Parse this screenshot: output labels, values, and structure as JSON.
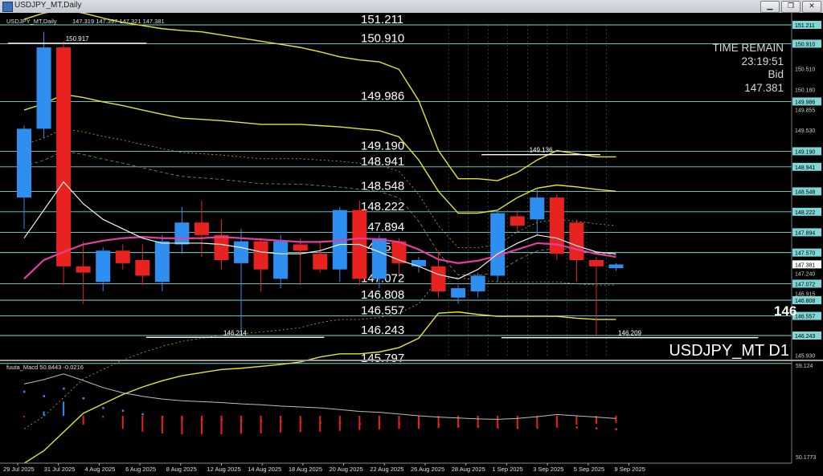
{
  "window": {
    "title": "USDJPY_MT,Daily",
    "buttons": {
      "minimize": "▁",
      "restore": "❐",
      "close": "✕"
    }
  },
  "header": {
    "symbol_info": "USDJPY_MT,Daily",
    "ohlc": "147.319 147.397 147.321 147.381"
  },
  "info_panel": {
    "line1": "TIME REMAIN",
    "line2": "23:19:51",
    "line3": "Bid",
    "line4": "147.381"
  },
  "watermark": "USDJPY_MT D1",
  "big_digit_fragment": "146",
  "colors": {
    "bull": "#2f8ff0",
    "bear": "#e8231f",
    "band": "#e6e62a",
    "hline": "#7ed6d6",
    "ma_pink": "#e040a0",
    "ma_white": "#f2f2f2",
    "grid": "#5a5a5a"
  },
  "level_lines": [
    {
      "price": "151.211",
      "val": 151.211
    },
    {
      "price": "150.910",
      "val": 150.91
    },
    {
      "price": "149.986",
      "val": 149.986
    },
    {
      "price": "149.190",
      "val": 149.19
    },
    {
      "price": "148.941",
      "val": 148.941
    },
    {
      "price": "148.548",
      "val": 148.548
    },
    {
      "price": "148.222",
      "val": 148.222
    },
    {
      "price": "147.894",
      "val": 147.894
    },
    {
      "price": "147.570",
      "val": 147.57
    },
    {
      "price": "147.072",
      "val": 147.072
    },
    {
      "price": "146.808",
      "val": 146.808
    },
    {
      "price": "146.557",
      "val": 146.557
    },
    {
      "price": "146.243",
      "val": 146.243
    },
    {
      "price": "145.797",
      "val": 145.797
    }
  ],
  "axis_prices": [
    {
      "price": "151.211",
      "val": 151.211,
      "boxed": true
    },
    {
      "price": "150.910",
      "val": 150.91,
      "boxed": true
    },
    {
      "price": "150.510",
      "val": 150.51,
      "boxed": false
    },
    {
      "price": "150.180",
      "val": 150.18,
      "boxed": false
    },
    {
      "price": "149.986",
      "val": 149.986,
      "boxed": true
    },
    {
      "price": "149.855",
      "val": 149.855,
      "boxed": false
    },
    {
      "price": "149.530",
      "val": 149.53,
      "boxed": false
    },
    {
      "price": "149.190",
      "val": 149.19,
      "boxed": true
    },
    {
      "price": "148.941",
      "val": 148.941,
      "boxed": true
    },
    {
      "price": "148.548",
      "val": 148.548,
      "boxed": true
    },
    {
      "price": "148.222",
      "val": 148.222,
      "boxed": true
    },
    {
      "price": "147.894",
      "val": 147.894,
      "boxed": true
    },
    {
      "price": "147.570",
      "val": 147.57,
      "boxed": true
    },
    {
      "price": "147.381",
      "val": 147.381,
      "boxed": "white"
    },
    {
      "price": "147.240",
      "val": 147.24,
      "boxed": false
    },
    {
      "price": "147.072",
      "val": 147.072,
      "boxed": true
    },
    {
      "price": "146.915",
      "val": 146.915,
      "boxed": false
    },
    {
      "price": "146.808",
      "val": 146.808,
      "boxed": true
    },
    {
      "price": "146.557",
      "val": 146.557,
      "boxed": true
    },
    {
      "price": "146.243",
      "val": 146.243,
      "boxed": true
    },
    {
      "price": "145.930",
      "val": 145.93,
      "boxed": false
    }
  ],
  "marker_labels": [
    {
      "text": "150.917",
      "val": 150.917,
      "i0": 0,
      "i1": 6
    },
    {
      "text": "149.136",
      "val": 149.136,
      "i0": 24,
      "i1": 29
    },
    {
      "text": "146.214",
      "val": 146.214,
      "i0": 7,
      "i1": 15
    },
    {
      "text": "146.209",
      "val": 146.209,
      "i0": 25,
      "i1": 37
    }
  ],
  "dates": [
    "29 Jul 2025",
    "31 Jul 2025",
    "4 Aug 2025",
    "6 Aug 2025",
    "8 Aug 2025",
    "12 Aug 2025",
    "14 Aug 2025",
    "18 Aug 2025",
    "20 Aug 2025",
    "22 Aug 2025",
    "26 Aug 2025",
    "28 Aug 2025",
    "1 Sep 2025",
    "3 Sep 2025",
    "5 Sep 2025",
    "9 Sep 2025"
  ],
  "chart_data": {
    "type": "candlestick",
    "candles": [
      {
        "o": 148.45,
        "h": 149.6,
        "l": 147.95,
        "c": 149.55
      },
      {
        "o": 149.55,
        "h": 151.1,
        "l": 149.4,
        "c": 150.85
      },
      {
        "o": 150.85,
        "h": 150.95,
        "l": 147.05,
        "c": 147.35
      },
      {
        "o": 147.35,
        "h": 147.75,
        "l": 146.75,
        "c": 147.25
      },
      {
        "o": 147.1,
        "h": 147.65,
        "l": 146.95,
        "c": 147.6
      },
      {
        "o": 147.6,
        "h": 147.7,
        "l": 147.3,
        "c": 147.4
      },
      {
        "o": 147.45,
        "h": 147.7,
        "l": 147.05,
        "c": 147.2
      },
      {
        "o": 147.1,
        "h": 147.85,
        "l": 146.95,
        "c": 147.75
      },
      {
        "o": 147.7,
        "h": 148.3,
        "l": 147.55,
        "c": 148.05
      },
      {
        "o": 148.05,
        "h": 148.4,
        "l": 147.5,
        "c": 147.85
      },
      {
        "o": 147.85,
        "h": 148.1,
        "l": 147.3,
        "c": 147.45
      },
      {
        "o": 147.4,
        "h": 147.95,
        "l": 146.25,
        "c": 147.75
      },
      {
        "o": 147.75,
        "h": 147.8,
        "l": 146.95,
        "c": 147.3
      },
      {
        "o": 147.15,
        "h": 147.85,
        "l": 147.0,
        "c": 147.75
      },
      {
        "o": 147.7,
        "h": 147.8,
        "l": 147.05,
        "c": 147.6
      },
      {
        "o": 147.55,
        "h": 147.75,
        "l": 147.25,
        "c": 147.3
      },
      {
        "o": 147.3,
        "h": 148.3,
        "l": 147.1,
        "c": 148.25
      },
      {
        "o": 148.25,
        "h": 148.4,
        "l": 147.05,
        "c": 147.15
      },
      {
        "o": 147.15,
        "h": 147.85,
        "l": 147.0,
        "c": 147.8
      },
      {
        "o": 147.75,
        "h": 147.8,
        "l": 147.2,
        "c": 147.4
      },
      {
        "o": 147.35,
        "h": 147.5,
        "l": 147.25,
        "c": 147.45
      },
      {
        "o": 147.35,
        "h": 147.6,
        "l": 146.85,
        "c": 146.95
      },
      {
        "o": 146.85,
        "h": 147.05,
        "l": 146.75,
        "c": 147.0
      },
      {
        "o": 146.95,
        "h": 147.25,
        "l": 146.85,
        "c": 147.2
      },
      {
        "o": 147.2,
        "h": 148.25,
        "l": 147.1,
        "c": 148.2
      },
      {
        "o": 148.15,
        "h": 148.25,
        "l": 147.9,
        "c": 148.0
      },
      {
        "o": 148.1,
        "h": 148.6,
        "l": 147.85,
        "c": 148.45
      },
      {
        "o": 148.45,
        "h": 148.5,
        "l": 147.45,
        "c": 147.55
      },
      {
        "o": 148.05,
        "h": 148.1,
        "l": 147.1,
        "c": 147.45
      },
      {
        "o": 147.45,
        "h": 147.5,
        "l": 146.25,
        "c": 147.35
      },
      {
        "o": 147.32,
        "h": 147.4,
        "l": 147.28,
        "c": 147.38
      }
    ],
    "ma_pink": [
      147.15,
      147.45,
      147.58,
      147.7,
      147.76,
      147.8,
      147.82,
      147.8,
      147.8,
      147.8,
      147.82,
      147.8,
      147.78,
      147.76,
      147.74,
      147.74,
      147.76,
      147.8,
      147.78,
      147.74,
      147.62,
      147.46,
      147.4,
      147.44,
      147.52,
      147.62,
      147.72,
      147.7,
      147.62,
      147.55,
      147.5
    ],
    "ma_white": [
      147.8,
      148.25,
      148.7,
      148.35,
      148.1,
      147.95,
      147.8,
      147.72,
      147.72,
      147.72,
      147.7,
      147.65,
      147.58,
      147.55,
      147.55,
      147.6,
      147.7,
      147.7,
      147.58,
      147.45,
      147.35,
      147.22,
      147.15,
      147.3,
      147.55,
      147.72,
      147.85,
      147.8,
      147.68,
      147.58,
      147.55
    ],
    "band_outer_top": [
      151.3,
      151.4,
      151.45,
      151.4,
      151.32,
      151.25,
      151.2,
      151.15,
      151.12,
      151.1,
      151.05,
      151.0,
      150.95,
      150.9,
      150.85,
      150.78,
      150.7,
      150.65,
      150.62,
      150.5,
      150.0,
      149.2,
      148.75,
      148.75,
      148.72,
      148.85,
      149.05,
      149.2,
      149.15,
      149.1,
      149.1
    ],
    "band_top": [
      149.85,
      149.95,
      150.1,
      150.05,
      149.98,
      149.92,
      149.85,
      149.78,
      149.72,
      149.7,
      149.68,
      149.65,
      149.62,
      149.62,
      149.62,
      149.6,
      149.58,
      149.55,
      149.52,
      149.42,
      149.05,
      148.55,
      148.2,
      148.2,
      148.25,
      148.45,
      148.6,
      148.65,
      148.62,
      148.58,
      148.55
    ],
    "band_bottom": [
      144.2,
      144.4,
      144.7,
      145.0,
      145.15,
      145.3,
      145.42,
      145.52,
      145.6,
      145.65,
      145.7,
      145.72,
      145.75,
      145.78,
      145.82,
      145.9,
      145.95,
      145.95,
      145.98,
      146.05,
      146.2,
      146.6,
      146.62,
      146.58,
      146.55,
      146.55,
      146.55,
      146.55,
      146.52,
      146.5,
      146.5
    ],
    "macd_title": "fuuta_Macd 50.8443 -0.0216",
    "macd_axis_top": "59.124",
    "macd_axis_bottom": "50.1773",
    "macd_line": [
      0.72,
      0.82,
      0.95,
      0.8,
      0.64,
      0.52,
      0.44,
      0.38,
      0.34,
      0.32,
      0.3,
      0.27,
      0.25,
      0.22,
      0.2,
      0.18,
      0.14,
      0.1,
      0.08,
      0.04,
      0.0,
      -0.03,
      -0.05,
      -0.07,
      -0.08,
      -0.06,
      -0.02,
      0.03,
      0.0,
      -0.03,
      -0.06
    ],
    "macd_hist": [
      -0.03,
      0.1,
      0.32,
      -0.2,
      -0.04,
      -0.3,
      -0.36,
      -0.4,
      -0.42,
      -0.42,
      -0.42,
      -0.41,
      -0.4,
      -0.38,
      -0.37,
      -0.36,
      -0.34,
      -0.32,
      -0.31,
      -0.3,
      -0.29,
      -0.28,
      -0.27,
      -0.27,
      -0.26,
      -0.25,
      -0.24,
      -0.22,
      -0.2,
      -0.18,
      -0.16
    ],
    "macd_signal": [
      0.55,
      0.45,
      0.62,
      0.4,
      0.18,
      0.12,
      0.04,
      -0.02,
      -0.06,
      -0.08,
      -0.08,
      -0.1,
      -0.12,
      -0.13,
      -0.14,
      -0.15,
      -0.16,
      -0.18,
      -0.18,
      -0.18,
      -0.18,
      -0.2,
      -0.22,
      -0.24,
      -0.26,
      -0.27,
      -0.26,
      -0.24,
      -0.26,
      -0.28,
      -0.3
    ]
  }
}
